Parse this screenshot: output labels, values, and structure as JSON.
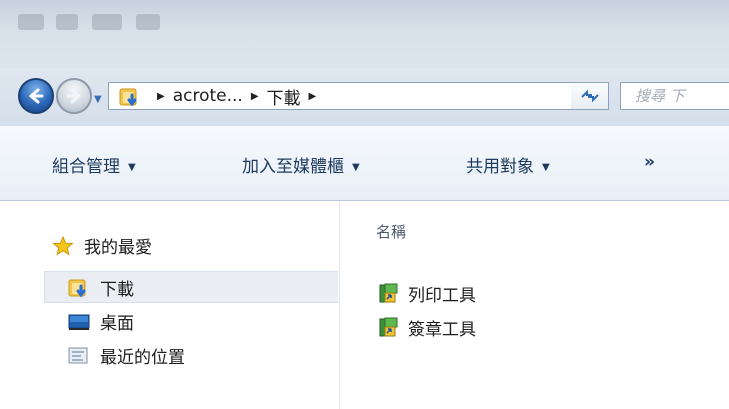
{
  "address": {
    "crumbs": [
      "acrote...",
      "下載"
    ],
    "search_placeholder": "搜尋 下"
  },
  "toolbar": {
    "organize": "組合管理",
    "include_library": "加入至媒體櫃",
    "share_with": "共用對象",
    "more": "»"
  },
  "nav": {
    "favorites": "我的最愛",
    "downloads": "下載",
    "desktop": "桌面",
    "recent": "最近的位置"
  },
  "content": {
    "column_name": "名稱",
    "files": [
      "列印工具",
      "簽章工具"
    ]
  }
}
